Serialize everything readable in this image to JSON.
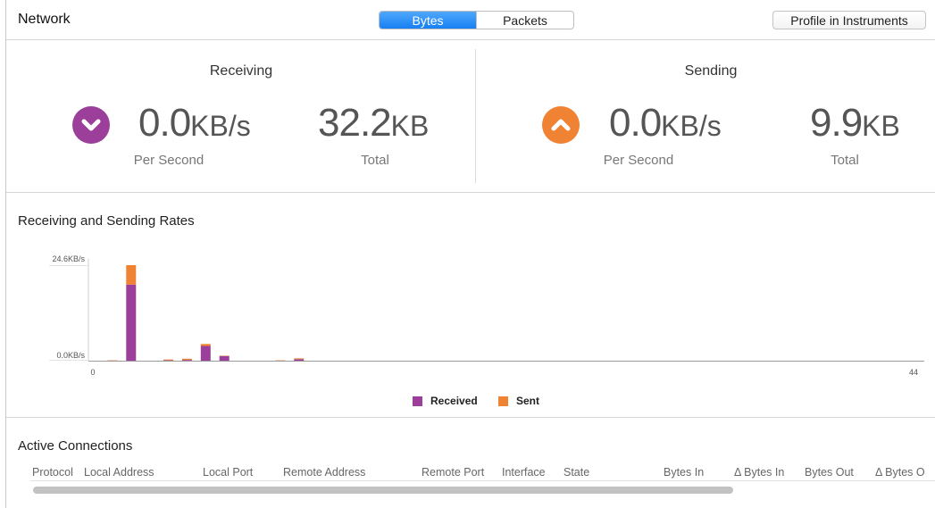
{
  "header": {
    "title": "Network",
    "tabs": [
      "Bytes",
      "Packets"
    ],
    "active_tab": "Bytes",
    "profile_label": "Profile in Instruments"
  },
  "receiving": {
    "title": "Receiving",
    "rate_value": "0.0",
    "rate_unit": "KB/s",
    "rate_label": "Per Second",
    "total_value": "32.2",
    "total_unit": "KB",
    "total_label": "Total",
    "color": "#9b3f9b",
    "icon": "chevron-down-icon"
  },
  "sending": {
    "title": "Sending",
    "rate_value": "0.0",
    "rate_unit": "KB/s",
    "rate_label": "Per Second",
    "total_value": "9.9",
    "total_unit": "KB",
    "total_label": "Total",
    "color": "#f08233",
    "icon": "chevron-up-icon"
  },
  "chart_title": "Receiving and Sending Rates",
  "chart_data": {
    "type": "bar",
    "stacked": true,
    "x_tick_labels": [
      "0",
      "44"
    ],
    "xlim": [
      0,
      44
    ],
    "y_tick_labels": [
      "24.6KB/s",
      "0.0KB/s"
    ],
    "ylim": [
      0,
      24.6
    ],
    "x": [
      1,
      2,
      3,
      4,
      5,
      6,
      7,
      8,
      9,
      10,
      11,
      12,
      13
    ],
    "series": [
      {
        "name": "Received",
        "color": "#9b3f9b",
        "values": [
          0,
          19.6,
          0,
          0.1,
          0.2,
          3.8,
          1.2,
          0,
          0,
          0,
          0.4,
          0,
          0
        ]
      },
      {
        "name": "Sent",
        "color": "#f08233",
        "values": [
          0.1,
          5.0,
          0,
          0.2,
          0.3,
          0.5,
          0.1,
          0,
          0,
          0.1,
          0.2,
          0,
          0
        ]
      }
    ],
    "legend_position": "bottom-center",
    "grid": false
  },
  "connections": {
    "title": "Active Connections",
    "columns": [
      "Protocol",
      "Local Address",
      "Local Port",
      "Remote Address",
      "Remote Port",
      "Interface",
      "State",
      "Bytes In",
      "Δ Bytes In",
      "Bytes Out",
      "Δ Bytes O"
    ]
  }
}
